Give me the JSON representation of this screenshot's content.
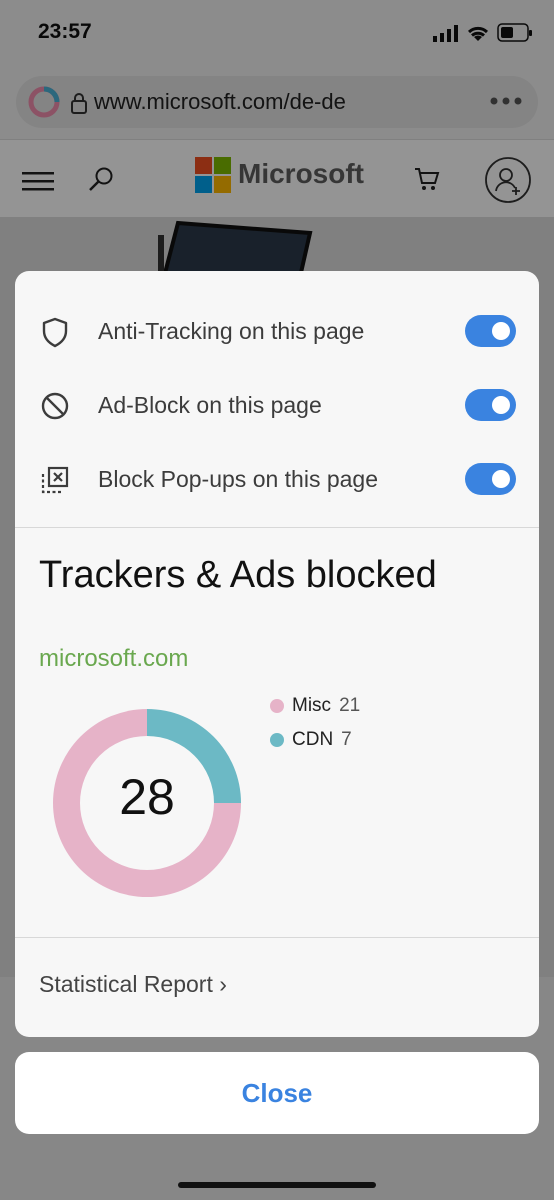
{
  "status_bar": {
    "time": "23:57"
  },
  "browser": {
    "url": "www.microsoft.com/de-de"
  },
  "site": {
    "brand": "Microsoft"
  },
  "panel": {
    "toggles": [
      {
        "label": "Anti-Tracking on this page",
        "icon": "shield-icon",
        "on": true
      },
      {
        "label": "Ad-Block on this page",
        "icon": "block-icon",
        "on": true
      },
      {
        "label": "Block Pop-ups on this page",
        "icon": "popup-block-icon",
        "on": true
      }
    ],
    "title": "Trackers & Ads blocked",
    "domain": "microsoft.com",
    "report_link": "Statistical Report ›"
  },
  "chart_data": {
    "type": "pie",
    "total": "28",
    "series": [
      {
        "name": "Misc",
        "value": 21,
        "color": "#e6b3c8"
      },
      {
        "name": "CDN",
        "value": 7,
        "color": "#6cb9c5"
      }
    ]
  },
  "close_label": "Close",
  "colors": {
    "accent": "#3a83e0",
    "domain_green": "#6aa84f"
  }
}
